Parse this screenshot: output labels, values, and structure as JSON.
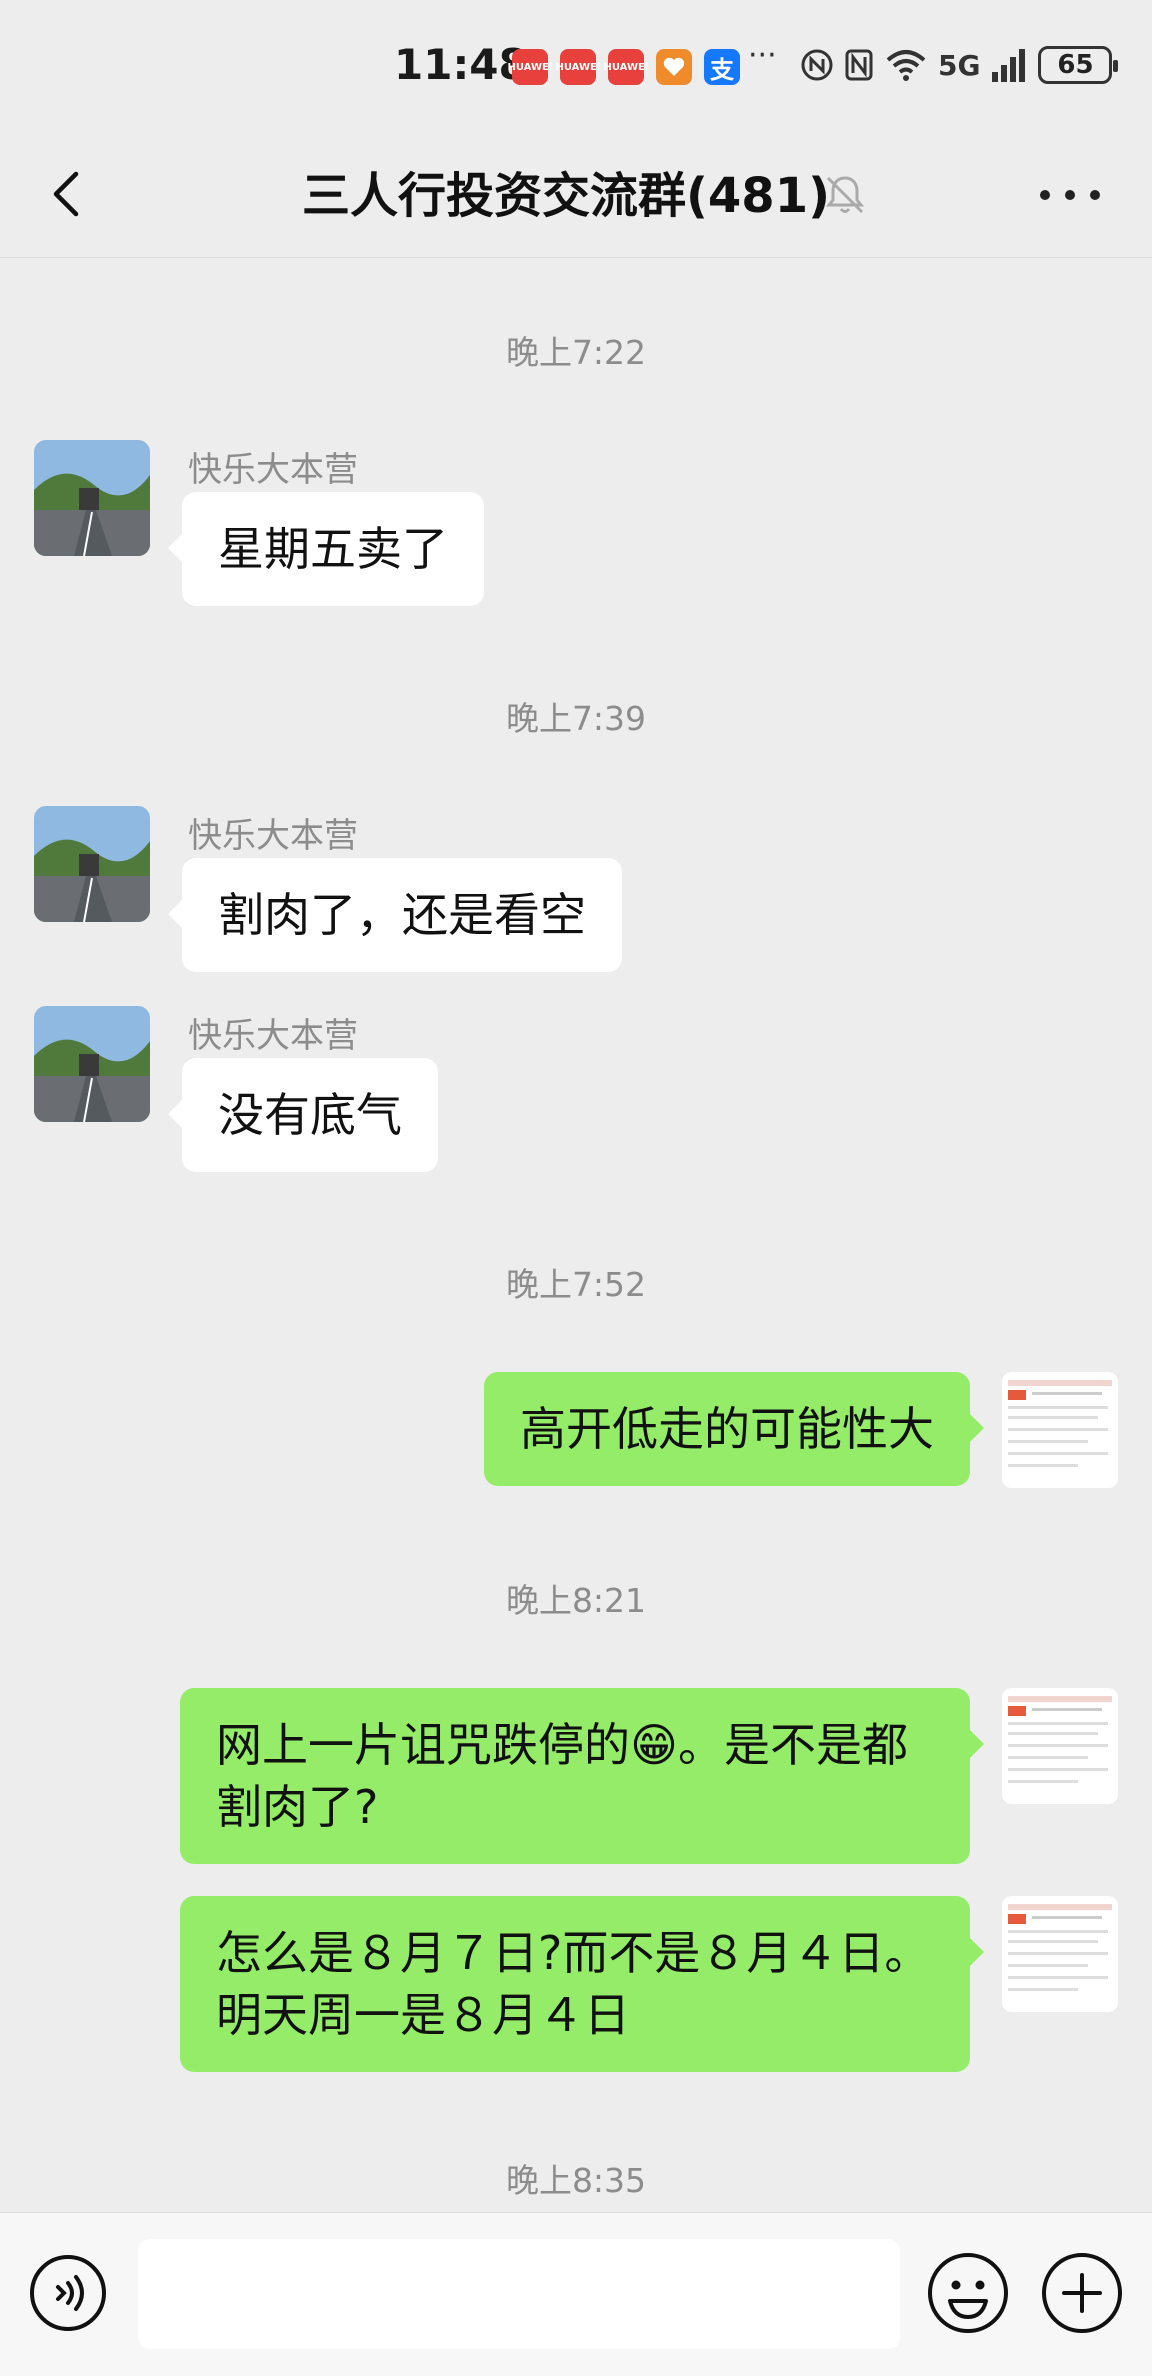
{
  "status_bar": {
    "time": "11:48",
    "app_icons": [
      "HUAWEI",
      "HUAWEI",
      "HUAWEI",
      "health",
      "支"
    ],
    "overflow": "···",
    "network": "5G",
    "battery": "65"
  },
  "header": {
    "title": "三人行投资交流群(481)"
  },
  "messages": {
    "t1": "晚上7:22",
    "m1_sender": "快乐大本营",
    "m1_text": "星期五卖了",
    "t2": "晚上7:39",
    "m2_sender": "快乐大本营",
    "m2_text": "割肉了，还是看空",
    "m3_sender": "快乐大本营",
    "m3_text": "没有底气",
    "t3": "晚上7:52",
    "m4_text": "高开低走的可能性大",
    "t4": "晚上8:21",
    "m5_text": "网上一片诅咒跌停的😁。是不是都割肉了?",
    "m6_text": "怎么是８月７日?而不是８月４日。明天周一是８月４日",
    "t5": "晚上8:35"
  },
  "input": {
    "placeholder": ""
  },
  "colors": {
    "background": "#ededed",
    "bubble_self": "#95ec69",
    "bubble_other": "#ffffff",
    "timestamp": "#8c8c8c"
  },
  "icons": [
    "back-icon",
    "mute-bell-icon",
    "more-icon",
    "voice-icon",
    "emoji-icon",
    "plus-icon"
  ]
}
